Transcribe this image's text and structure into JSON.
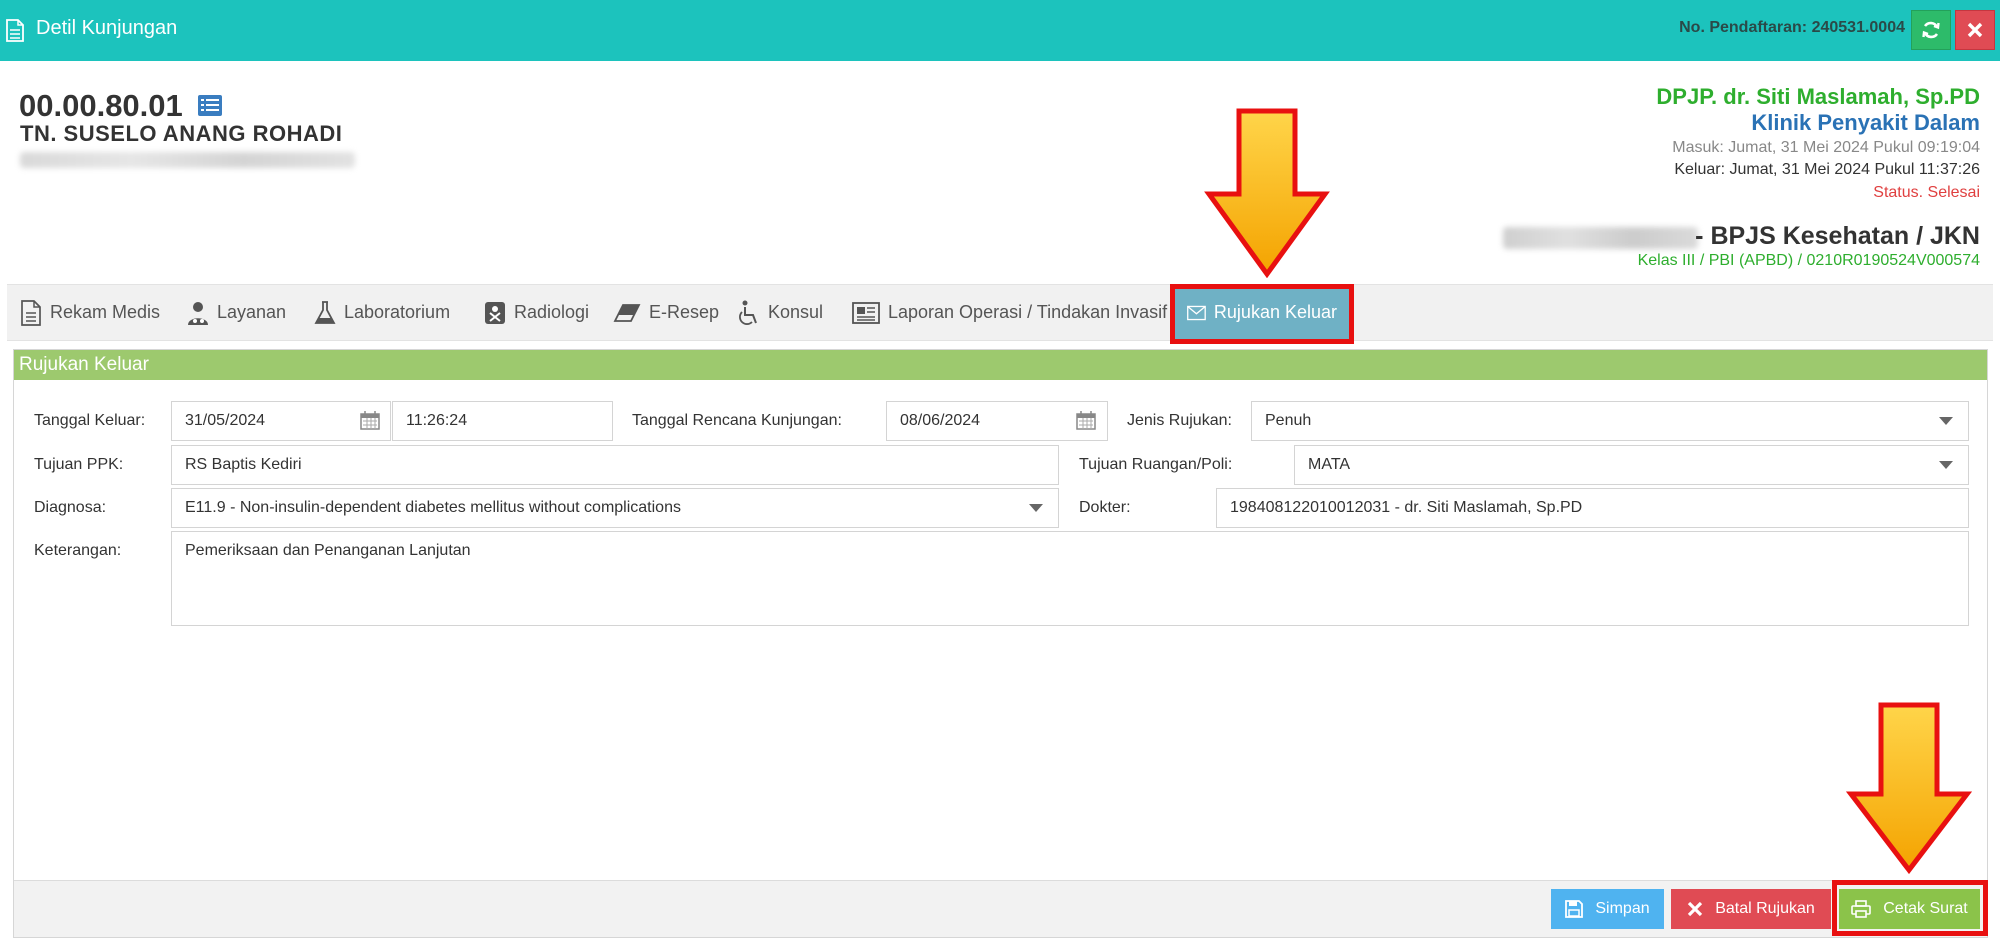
{
  "titlebar": {
    "title": "Detil Kunjungan",
    "registration": "No. Pendaftaran: 240531.0004",
    "refresh_icon": "refresh-icon",
    "close_icon": "close-icon",
    "color": "#1cc3bd"
  },
  "patient": {
    "id": "00.00.80.01",
    "name": "TN. SUSELO ANANG ROHADI"
  },
  "visit": {
    "dpjp": "DPJP. dr. Siti Maslamah, Sp.PD",
    "klinik": "Klinik Penyakit Dalam",
    "masuk": "Masuk: Jumat, 31 Mei 2024 Pukul 09:19:04",
    "keluar": "Keluar: Jumat, 31 Mei 2024 Pukul 11:37:26",
    "status": "Status. Selesai",
    "penjamin": "- BPJS Kesehatan / JKN",
    "kelas": "Kelas III / PBI (APBD) / 0210R0190524V000574"
  },
  "tabs": [
    {
      "label": "Rekam Medis",
      "icon": "document-icon"
    },
    {
      "label": "Layanan",
      "icon": "doctor-icon"
    },
    {
      "label": "Laboratorium",
      "icon": "flask-icon"
    },
    {
      "label": "Radiologi",
      "icon": "radiology-icon"
    },
    {
      "label": "E-Resep",
      "icon": "eraser-icon"
    },
    {
      "label": "Konsul",
      "icon": "wheelchair-icon"
    },
    {
      "label": "Laporan Operasi / Tindakan Invasif",
      "icon": "newspaper-icon"
    },
    {
      "label": "Rujukan Keluar",
      "icon": "envelope-icon",
      "active": true
    }
  ],
  "form": {
    "title": "Rujukan Keluar",
    "tanggal_keluar_label": "Tanggal Keluar:",
    "tanggal_keluar": "31/05/2024",
    "jam_keluar": "11:26:24",
    "tanggal_rencana_label": "Tanggal Rencana Kunjungan:",
    "tanggal_rencana": "08/06/2024",
    "jenis_rujukan_label": "Jenis Rujukan:",
    "jenis_rujukan": "Penuh",
    "tujuan_ppk_label": "Tujuan PPK:",
    "tujuan_ppk": "RS Baptis Kediri",
    "tujuan_poli_label": "Tujuan Ruangan/Poli:",
    "tujuan_poli": "MATA",
    "diagnosa_label": "Diagnosa:",
    "diagnosa": "E11.9 - Non-insulin-dependent diabetes mellitus without complications",
    "dokter_label": "Dokter:",
    "dokter": "198408122010012031 - dr. Siti Maslamah, Sp.PD",
    "keterangan_label": "Keterangan:",
    "keterangan": "Pemeriksaan dan Penanganan Lanjutan"
  },
  "actions": {
    "simpan": "Simpan",
    "batal": "Batal Rujukan",
    "cetak": "Cetak Surat"
  },
  "colors": {
    "accent": "#1cc3bd",
    "panel_header": "#9dc96e",
    "active_tab": "#6fb1c5",
    "annotation": "#e81010",
    "arrow": "#ffc20e"
  }
}
